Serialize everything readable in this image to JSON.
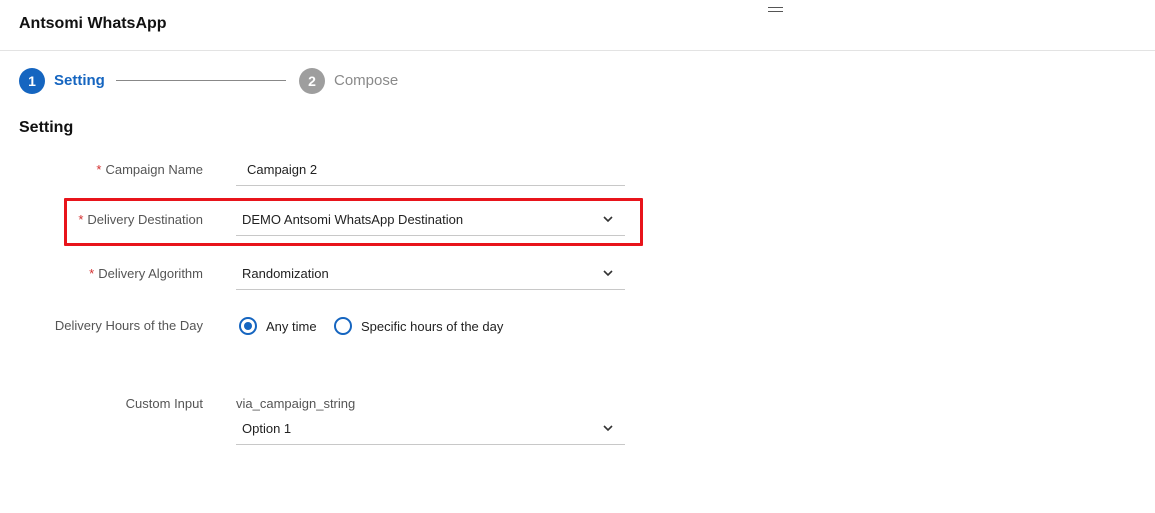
{
  "app": {
    "title": "Antsomi WhatsApp"
  },
  "stepper": {
    "steps": [
      {
        "number": "1",
        "label": "Setting",
        "active": true
      },
      {
        "number": "2",
        "label": "Compose",
        "active": false
      }
    ]
  },
  "section": {
    "title": "Setting"
  },
  "form": {
    "campaign_name": {
      "label": "Campaign Name",
      "required": "*",
      "value": "Campaign 2"
    },
    "delivery_destination": {
      "label": "Delivery Destination",
      "required": "*",
      "value": "DEMO Antsomi WhatsApp Destination"
    },
    "delivery_algorithm": {
      "label": "Delivery Algorithm",
      "required": "*",
      "value": "Randomization"
    },
    "delivery_hours": {
      "label": "Delivery Hours of the Day",
      "options": [
        {
          "label": "Any time",
          "checked": true
        },
        {
          "label": "Specific hours of the day",
          "checked": false
        }
      ]
    },
    "custom_input": {
      "label": "Custom Input",
      "sub_label": "via_campaign_string",
      "value": "Option 1"
    }
  },
  "colors": {
    "accent": "#1565c0",
    "inactive_step": "#9e9e9e",
    "required": "#d32f2f",
    "highlight": "#e8141b"
  },
  "icons": {
    "dropdown": "chevron-down-icon",
    "drag": "drag-handle-icon"
  }
}
